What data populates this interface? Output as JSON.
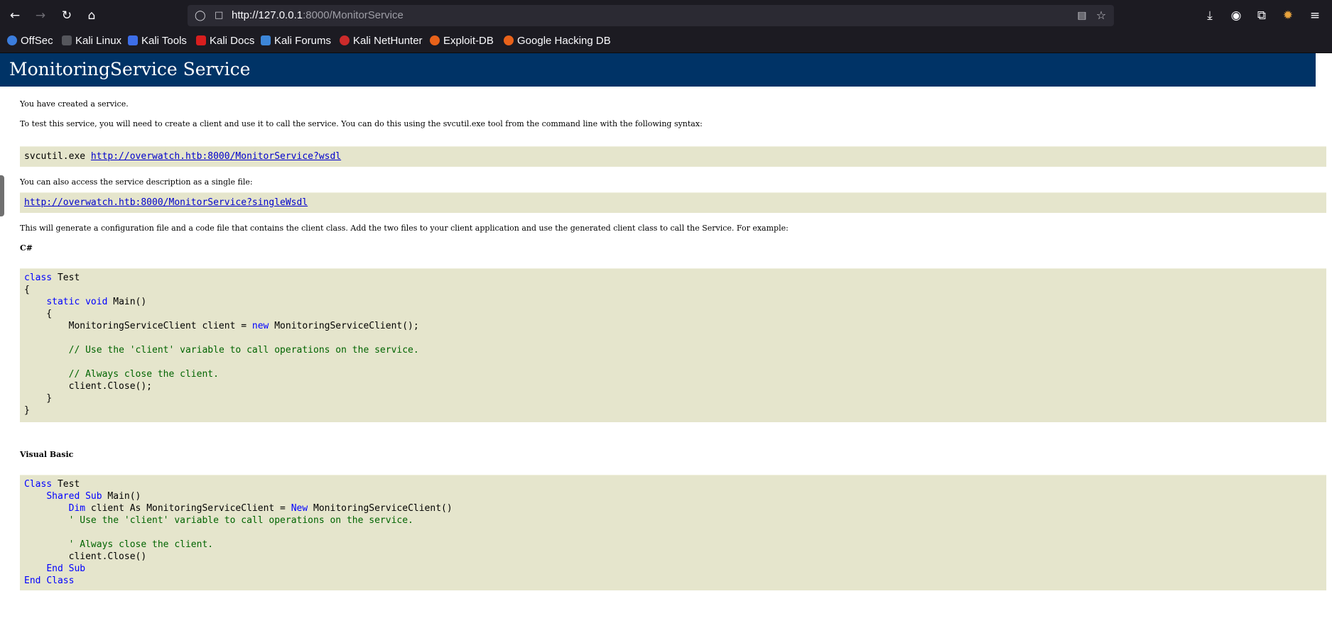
{
  "browser": {
    "url_host": "http://127.0.0.1",
    "url_rest": ":8000/MonitorService",
    "bookmarks": [
      {
        "label": "OffSec",
        "color": "#3b7ddd"
      },
      {
        "label": "Kali Linux",
        "color": "#1c1b22"
      },
      {
        "label": "Kali Tools",
        "color": "#3d6ee8"
      },
      {
        "label": "Kali Docs",
        "color": "#d81e1e"
      },
      {
        "label": "Kali Forums",
        "color": "#3d86d8"
      },
      {
        "label": "Kali NetHunter",
        "color": "#cc2b2b"
      },
      {
        "label": "Exploit-DB",
        "color": "#e8621a"
      },
      {
        "label": "Google Hacking DB",
        "color": "#e8621a"
      }
    ],
    "icons": {
      "back": "back-arrow-icon",
      "forward": "forward-arrow-icon",
      "reload": "reload-icon",
      "home": "home-icon",
      "downloads": "download-icon",
      "account": "account-icon",
      "extensions": "extensions-icon",
      "menu": "hamburger-menu-icon"
    }
  },
  "page": {
    "title": "MonitoringService Service",
    "intro": "You have created a service.",
    "instructions": "To test this service, you will need to create a client and use it to call the service. You can do this using the svcutil.exe tool from the command line with the following syntax:",
    "svcutil_cmd": "svcutil.exe ",
    "wsdl_url": "http://overwatch.htb:8000/MonitorService?wsdl",
    "single_file_text": "You can also access the service description as a single file:",
    "single_wsdl_url": "http://overwatch.htb:8000/MonitorService?singleWsdl",
    "generate_text": "This will generate a configuration file and a code file that contains the client class. Add the two files to your client application and use the generated client class to call the Service. For example:",
    "csharp_label": "C#",
    "vb_label": "Visual Basic"
  },
  "colors": {
    "header_bg": "#003366",
    "code_bg": "#e5e5cc",
    "keyword": "#0000ff",
    "comment": "#006400",
    "link": "#0000cc"
  }
}
